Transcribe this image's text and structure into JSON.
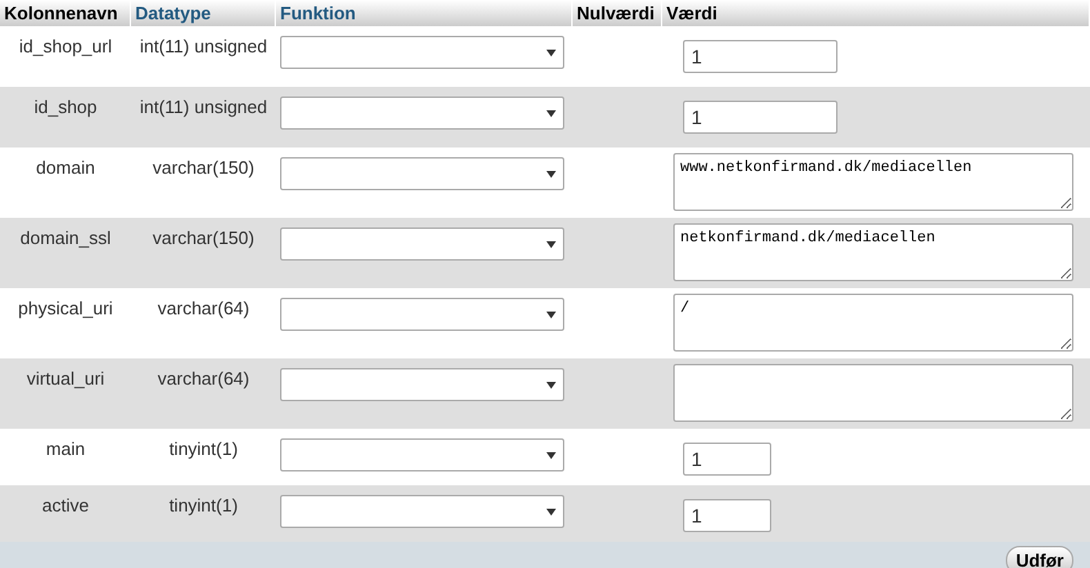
{
  "columns": [
    {
      "label": "Kolonnenavn",
      "link": false
    },
    {
      "label": "Datatype",
      "link": true
    },
    {
      "label": "Funktion",
      "link": true
    },
    {
      "label": "Nulværdi",
      "link": false
    },
    {
      "label": "Værdi",
      "link": false
    }
  ],
  "rows": [
    {
      "name": "id_shop_url",
      "type": "int(11) unsigned",
      "kind": "input",
      "value": "1"
    },
    {
      "name": "id_shop",
      "type": "int(11) unsigned",
      "kind": "input",
      "value": "1"
    },
    {
      "name": "domain",
      "type": "varchar(150)",
      "kind": "textarea",
      "value": "www.netkonfirmand.dk/mediacellen"
    },
    {
      "name": "domain_ssl",
      "type": "varchar(150)",
      "kind": "textarea",
      "value": "netkonfirmand.dk/mediacellen"
    },
    {
      "name": "physical_uri",
      "type": "varchar(64)",
      "kind": "textarea",
      "value": "/"
    },
    {
      "name": "virtual_uri",
      "type": "varchar(64)",
      "kind": "textarea",
      "value": ""
    },
    {
      "name": "main",
      "type": "tinyint(1)",
      "kind": "short-input",
      "value": "1"
    },
    {
      "name": "active",
      "type": "tinyint(1)",
      "kind": "short-input",
      "value": "1"
    }
  ],
  "submit": "Udfør"
}
